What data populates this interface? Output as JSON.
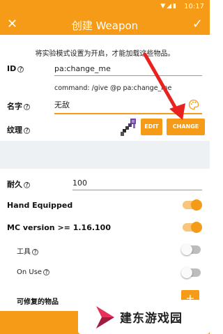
{
  "status_bar": {
    "time": "10:17",
    "icons": "▼◢▮"
  },
  "app_bar": {
    "close_icon": "✕",
    "title": "创建 Weapon",
    "confirm_icon": "✓"
  },
  "notice": "将实验模式设置为开启，才能加载这些物品。",
  "id_field": {
    "label": "ID",
    "help_icon": "?",
    "value": "pa:change_me"
  },
  "command": "command: /give @p pa:change_me",
  "name_field": {
    "label": "名字",
    "help_icon": "?",
    "value": "无敌"
  },
  "texture": {
    "label": "纹理",
    "help_icon": "?",
    "edit_label": "EDIT",
    "change_label": "CHANGE"
  },
  "durability": {
    "label": "耐久",
    "help_icon": "?",
    "value": "100"
  },
  "toggles": [
    {
      "label": "Hand Equipped",
      "state": "on"
    },
    {
      "label": "MC version >= 1.16.100",
      "state": "on"
    },
    {
      "label": "工具",
      "help_icon": "?",
      "state": "off"
    },
    {
      "label": "On Use",
      "help_icon": "?",
      "state": "off"
    }
  ],
  "repairable": {
    "label": "可修复的物品",
    "add_label": "+"
  },
  "watermark": {
    "text": "建东游戏园"
  },
  "colors": {
    "accent": "#f59b17",
    "arrow": "#e8231f"
  }
}
